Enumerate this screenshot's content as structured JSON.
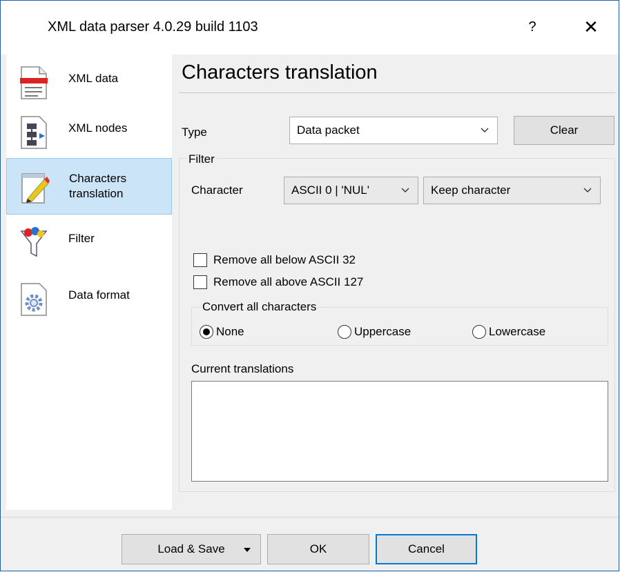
{
  "window": {
    "title": "XML data parser 4.0.29 build 1103",
    "help_label": "?",
    "close_label": "✕"
  },
  "sidebar": {
    "items": [
      {
        "label": "XML data",
        "icon": "xml-document-icon"
      },
      {
        "label": "XML nodes",
        "icon": "xml-nodes-icon"
      },
      {
        "label_line1": "Characters",
        "label_line2": "translation",
        "icon": "pencil-edit-icon",
        "selected": true
      },
      {
        "label": "Filter",
        "icon": "filter-funnel-icon"
      },
      {
        "label": "Data format",
        "icon": "gear-document-icon"
      }
    ]
  },
  "main": {
    "heading": "Characters translation",
    "type_label": "Type",
    "type_value": "Data packet",
    "clear_label": "Clear",
    "filter_caption": "Filter",
    "character_label": "Character",
    "character_value": "ASCII 0 | 'NUL'",
    "action_value": "Keep character",
    "remove_below_label": "Remove all below ASCII 32",
    "remove_below_checked": false,
    "remove_above_label": "Remove all above ASCII 127",
    "remove_above_checked": false,
    "convert_caption": "Convert all characters",
    "convert_options": [
      {
        "label": "None",
        "selected": true
      },
      {
        "label": "Uppercase",
        "selected": false
      },
      {
        "label": "Lowercase",
        "selected": false
      }
    ],
    "current_label": "Current translations",
    "current_items": []
  },
  "footer": {
    "load_save_label": "Load & Save",
    "ok_label": "OK",
    "cancel_label": "Cancel"
  },
  "colors": {
    "accent": "#0078d7",
    "selection": "#cce4f7"
  }
}
